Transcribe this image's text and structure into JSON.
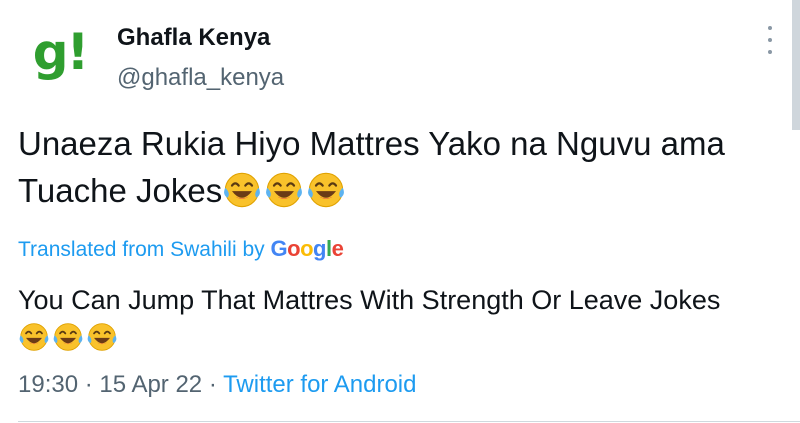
{
  "author": {
    "avatar_text": "g!",
    "display_name": "Ghafla Kenya",
    "handle": "@ghafla_kenya"
  },
  "tweet": {
    "text": "Unaeza Rukia Hiyo Mattres Yako na Nguvu ama Tuache Jokes",
    "emoji_count": 3
  },
  "translation": {
    "label": "Translated from Swahili by",
    "provider": "Google",
    "text": "You Can Jump That Mattres With Strength Or Leave Jokes",
    "emoji_count": 3
  },
  "meta": {
    "time": "19:30",
    "separator": "·",
    "date": "15 Apr 22",
    "source": "Twitter for Android"
  },
  "icons": {
    "more": "more-vertical-icon",
    "emoji": "face-with-tears-of-joy"
  },
  "colors": {
    "link": "#1d9bf0",
    "secondary_text": "#536471",
    "logo_green": "#2f9e2f",
    "emoji_face": "#f9c22b"
  }
}
